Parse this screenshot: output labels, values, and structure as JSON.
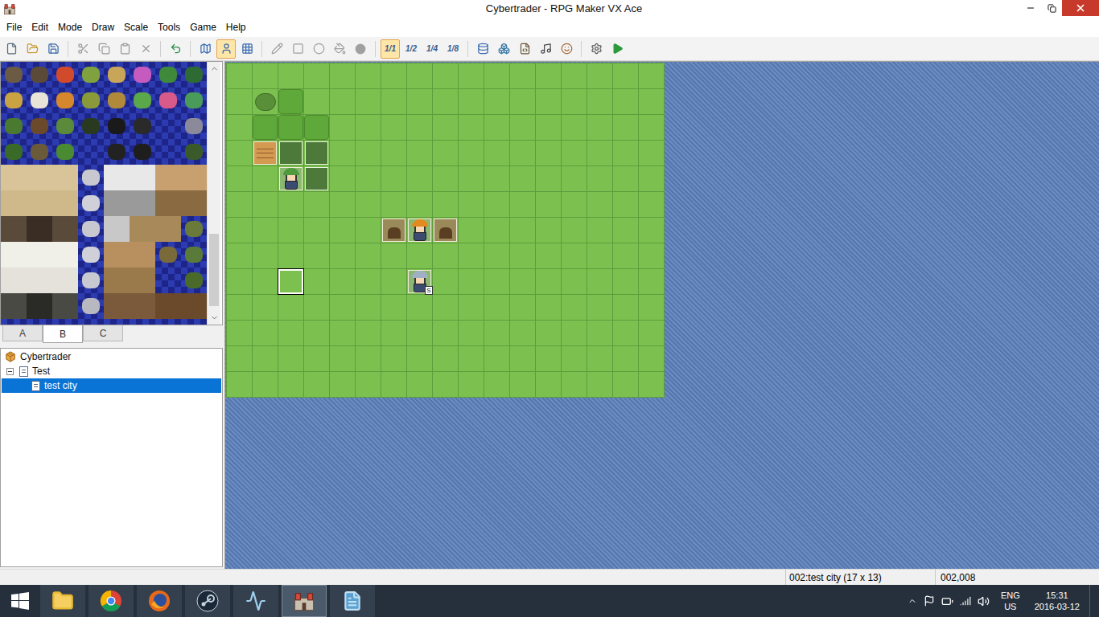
{
  "window": {
    "title": "Cybertrader - RPG Maker VX Ace"
  },
  "menu": [
    "File",
    "Edit",
    "Mode",
    "Draw",
    "Scale",
    "Tools",
    "Game",
    "Help"
  ],
  "toolbar": {
    "modes": [
      {
        "mode": "map",
        "selected": false
      },
      {
        "mode": "event",
        "selected": true
      },
      {
        "mode": "region",
        "selected": false
      }
    ],
    "scales": [
      {
        "label": "1/1",
        "selected": true
      },
      {
        "label": "1/2",
        "selected": false
      },
      {
        "label": "1/4",
        "selected": false
      },
      {
        "label": "1/8",
        "selected": false
      }
    ]
  },
  "tileset": {
    "tabs": [
      {
        "label": "A",
        "selected": false
      },
      {
        "label": "B",
        "selected": true
      },
      {
        "label": "C",
        "selected": false
      }
    ],
    "scrollbar": {
      "level": 0.97
    }
  },
  "tree": [
    {
      "label": "Cybertrader",
      "level": 0,
      "kind": "project",
      "has_children": true,
      "expanded": true,
      "selected": false
    },
    {
      "label": "Test",
      "level": 1,
      "kind": "map",
      "has_children": true,
      "expanded": true,
      "selected": false
    },
    {
      "label": "test city",
      "level": 2,
      "kind": "map",
      "has_children": false,
      "expanded": false,
      "selected": true
    }
  ],
  "map": {
    "cols": 17,
    "rows": 13,
    "tiles": [
      {
        "x": 1,
        "y": 1,
        "kind": "bush"
      },
      {
        "x": 2,
        "y": 1,
        "kind": "foliage"
      },
      {
        "x": 1,
        "y": 2,
        "kind": "foliage"
      },
      {
        "x": 2,
        "y": 2,
        "kind": "foliage"
      },
      {
        "x": 3,
        "y": 2,
        "kind": "foliage"
      }
    ],
    "events": [
      {
        "x": 1,
        "y": 3,
        "kind": "crate"
      },
      {
        "x": 2,
        "y": 3,
        "kind": "empty"
      },
      {
        "x": 3,
        "y": 3,
        "kind": "empty"
      },
      {
        "x": 3,
        "y": 4,
        "kind": "empty"
      },
      {
        "x": 2,
        "y": 4,
        "kind": "character",
        "color": "#4f9a3c"
      },
      {
        "x": 6,
        "y": 6,
        "kind": "stump"
      },
      {
        "x": 7,
        "y": 6,
        "kind": "character",
        "color": "#e28a1e"
      },
      {
        "x": 8,
        "y": 6,
        "kind": "stump"
      },
      {
        "x": 7,
        "y": 8,
        "kind": "character",
        "color": "#9fb0c4",
        "badge": "S"
      }
    ],
    "cursor": {
      "x": 2,
      "y": 8
    }
  },
  "status_bar": {
    "map": "002:test city (17 x 13)",
    "position": "002,008"
  },
  "taskbar": {
    "apps": [
      {
        "app": "explorer",
        "active": false
      },
      {
        "app": "chrome",
        "active": false
      },
      {
        "app": "firefox",
        "active": false
      },
      {
        "app": "steam",
        "active": false
      },
      {
        "app": "monitor",
        "active": false
      },
      {
        "app": "rpgmaker",
        "active": true
      },
      {
        "app": "notes",
        "active": false
      }
    ],
    "language": "ENG",
    "region": "US",
    "time": "15:31",
    "date": "2016-03-12"
  }
}
